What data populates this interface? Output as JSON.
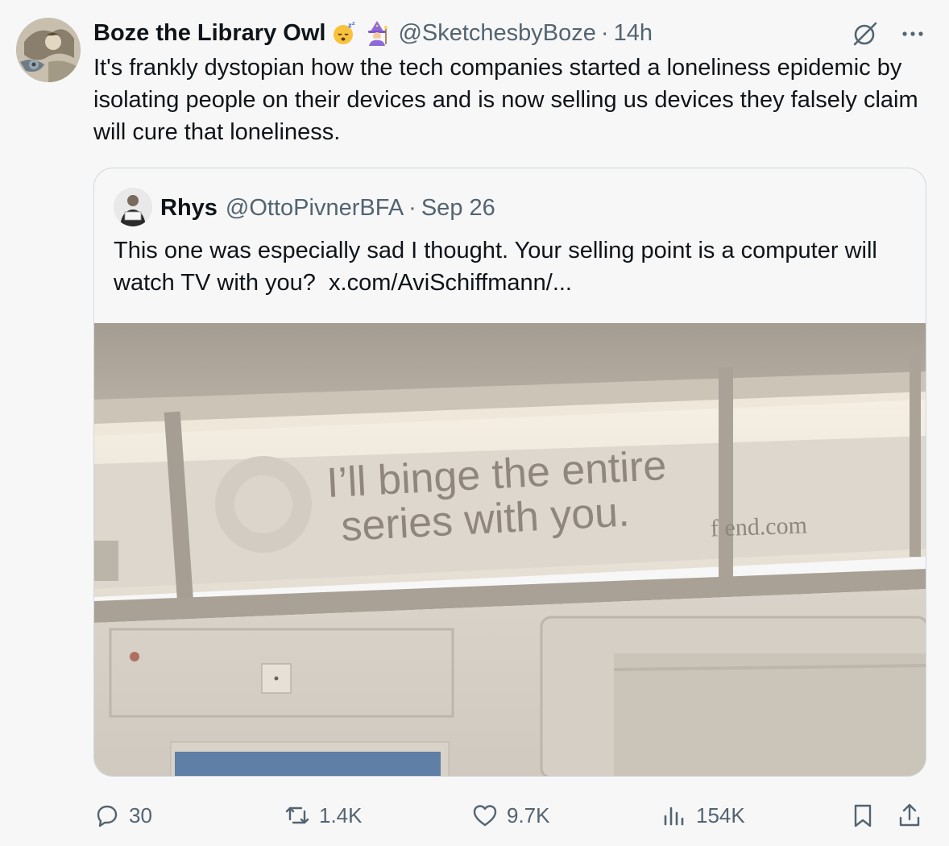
{
  "tweet": {
    "author_name": "Boze the Library Owl",
    "author_emojis": [
      "sleeping-face-emoji",
      "mage-emoji"
    ],
    "handle": "@SketchesbyBoze",
    "separator": "·",
    "time": "14h",
    "text": "It's frankly dystopian how the tech companies started a loneliness epidemic by isolating people on their devices and is now selling us devices they falsely claim will cure that loneliness."
  },
  "quote": {
    "author_name": "Rhys",
    "handle": "@OttoPivnerBFA",
    "separator": "·",
    "date": "Sep 26",
    "text": "This one was especially sad I thought. Your selling point is a computer will watch TV with you?",
    "link": "x.com/AviSchiffmann/...",
    "image": {
      "ad_line1": "I’ll binge the entire",
      "ad_line2": "series with you.",
      "ad_brand": "f  end.com"
    }
  },
  "actions": {
    "replies": "30",
    "reposts": "1.4K",
    "likes": "9.7K",
    "views": "154K"
  },
  "colors": {
    "text": "#0f1419",
    "secondary": "#536471",
    "border": "#cfd9de",
    "background": "#f7f7f7"
  },
  "icons": [
    "grok-icon",
    "more-icon",
    "reply-icon",
    "repost-icon",
    "like-icon",
    "views-icon",
    "bookmark-icon",
    "share-icon"
  ]
}
